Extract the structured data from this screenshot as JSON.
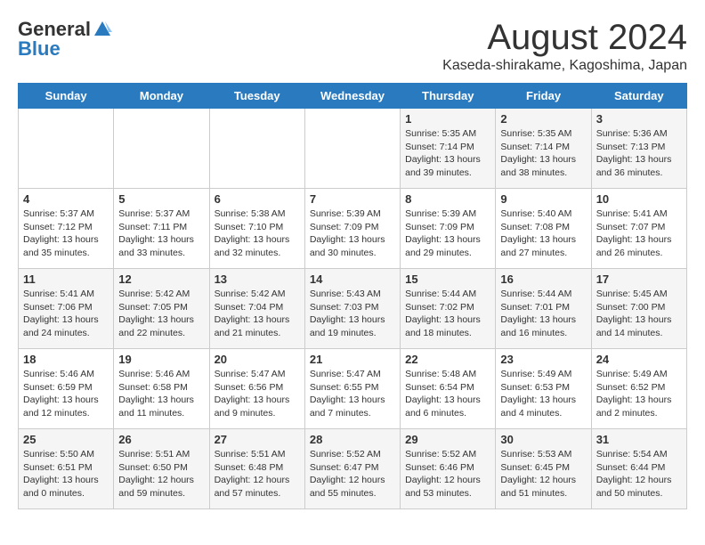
{
  "logo": {
    "general": "General",
    "blue": "Blue"
  },
  "header": {
    "month_year": "August 2024",
    "location": "Kaseda-shirakame, Kagoshima, Japan"
  },
  "days_of_week": [
    "Sunday",
    "Monday",
    "Tuesday",
    "Wednesday",
    "Thursday",
    "Friday",
    "Saturday"
  ],
  "weeks": [
    [
      {
        "day": "",
        "content": ""
      },
      {
        "day": "",
        "content": ""
      },
      {
        "day": "",
        "content": ""
      },
      {
        "day": "",
        "content": ""
      },
      {
        "day": "1",
        "content": "Sunrise: 5:35 AM\nSunset: 7:14 PM\nDaylight: 13 hours\nand 39 minutes."
      },
      {
        "day": "2",
        "content": "Sunrise: 5:35 AM\nSunset: 7:14 PM\nDaylight: 13 hours\nand 38 minutes."
      },
      {
        "day": "3",
        "content": "Sunrise: 5:36 AM\nSunset: 7:13 PM\nDaylight: 13 hours\nand 36 minutes."
      }
    ],
    [
      {
        "day": "4",
        "content": "Sunrise: 5:37 AM\nSunset: 7:12 PM\nDaylight: 13 hours\nand 35 minutes."
      },
      {
        "day": "5",
        "content": "Sunrise: 5:37 AM\nSunset: 7:11 PM\nDaylight: 13 hours\nand 33 minutes."
      },
      {
        "day": "6",
        "content": "Sunrise: 5:38 AM\nSunset: 7:10 PM\nDaylight: 13 hours\nand 32 minutes."
      },
      {
        "day": "7",
        "content": "Sunrise: 5:39 AM\nSunset: 7:09 PM\nDaylight: 13 hours\nand 30 minutes."
      },
      {
        "day": "8",
        "content": "Sunrise: 5:39 AM\nSunset: 7:09 PM\nDaylight: 13 hours\nand 29 minutes."
      },
      {
        "day": "9",
        "content": "Sunrise: 5:40 AM\nSunset: 7:08 PM\nDaylight: 13 hours\nand 27 minutes."
      },
      {
        "day": "10",
        "content": "Sunrise: 5:41 AM\nSunset: 7:07 PM\nDaylight: 13 hours\nand 26 minutes."
      }
    ],
    [
      {
        "day": "11",
        "content": "Sunrise: 5:41 AM\nSunset: 7:06 PM\nDaylight: 13 hours\nand 24 minutes."
      },
      {
        "day": "12",
        "content": "Sunrise: 5:42 AM\nSunset: 7:05 PM\nDaylight: 13 hours\nand 22 minutes."
      },
      {
        "day": "13",
        "content": "Sunrise: 5:42 AM\nSunset: 7:04 PM\nDaylight: 13 hours\nand 21 minutes."
      },
      {
        "day": "14",
        "content": "Sunrise: 5:43 AM\nSunset: 7:03 PM\nDaylight: 13 hours\nand 19 minutes."
      },
      {
        "day": "15",
        "content": "Sunrise: 5:44 AM\nSunset: 7:02 PM\nDaylight: 13 hours\nand 18 minutes."
      },
      {
        "day": "16",
        "content": "Sunrise: 5:44 AM\nSunset: 7:01 PM\nDaylight: 13 hours\nand 16 minutes."
      },
      {
        "day": "17",
        "content": "Sunrise: 5:45 AM\nSunset: 7:00 PM\nDaylight: 13 hours\nand 14 minutes."
      }
    ],
    [
      {
        "day": "18",
        "content": "Sunrise: 5:46 AM\nSunset: 6:59 PM\nDaylight: 13 hours\nand 12 minutes."
      },
      {
        "day": "19",
        "content": "Sunrise: 5:46 AM\nSunset: 6:58 PM\nDaylight: 13 hours\nand 11 minutes."
      },
      {
        "day": "20",
        "content": "Sunrise: 5:47 AM\nSunset: 6:56 PM\nDaylight: 13 hours\nand 9 minutes."
      },
      {
        "day": "21",
        "content": "Sunrise: 5:47 AM\nSunset: 6:55 PM\nDaylight: 13 hours\nand 7 minutes."
      },
      {
        "day": "22",
        "content": "Sunrise: 5:48 AM\nSunset: 6:54 PM\nDaylight: 13 hours\nand 6 minutes."
      },
      {
        "day": "23",
        "content": "Sunrise: 5:49 AM\nSunset: 6:53 PM\nDaylight: 13 hours\nand 4 minutes."
      },
      {
        "day": "24",
        "content": "Sunrise: 5:49 AM\nSunset: 6:52 PM\nDaylight: 13 hours\nand 2 minutes."
      }
    ],
    [
      {
        "day": "25",
        "content": "Sunrise: 5:50 AM\nSunset: 6:51 PM\nDaylight: 13 hours\nand 0 minutes."
      },
      {
        "day": "26",
        "content": "Sunrise: 5:51 AM\nSunset: 6:50 PM\nDaylight: 12 hours\nand 59 minutes."
      },
      {
        "day": "27",
        "content": "Sunrise: 5:51 AM\nSunset: 6:48 PM\nDaylight: 12 hours\nand 57 minutes."
      },
      {
        "day": "28",
        "content": "Sunrise: 5:52 AM\nSunset: 6:47 PM\nDaylight: 12 hours\nand 55 minutes."
      },
      {
        "day": "29",
        "content": "Sunrise: 5:52 AM\nSunset: 6:46 PM\nDaylight: 12 hours\nand 53 minutes."
      },
      {
        "day": "30",
        "content": "Sunrise: 5:53 AM\nSunset: 6:45 PM\nDaylight: 12 hours\nand 51 minutes."
      },
      {
        "day": "31",
        "content": "Sunrise: 5:54 AM\nSunset: 6:44 PM\nDaylight: 12 hours\nand 50 minutes."
      }
    ]
  ]
}
